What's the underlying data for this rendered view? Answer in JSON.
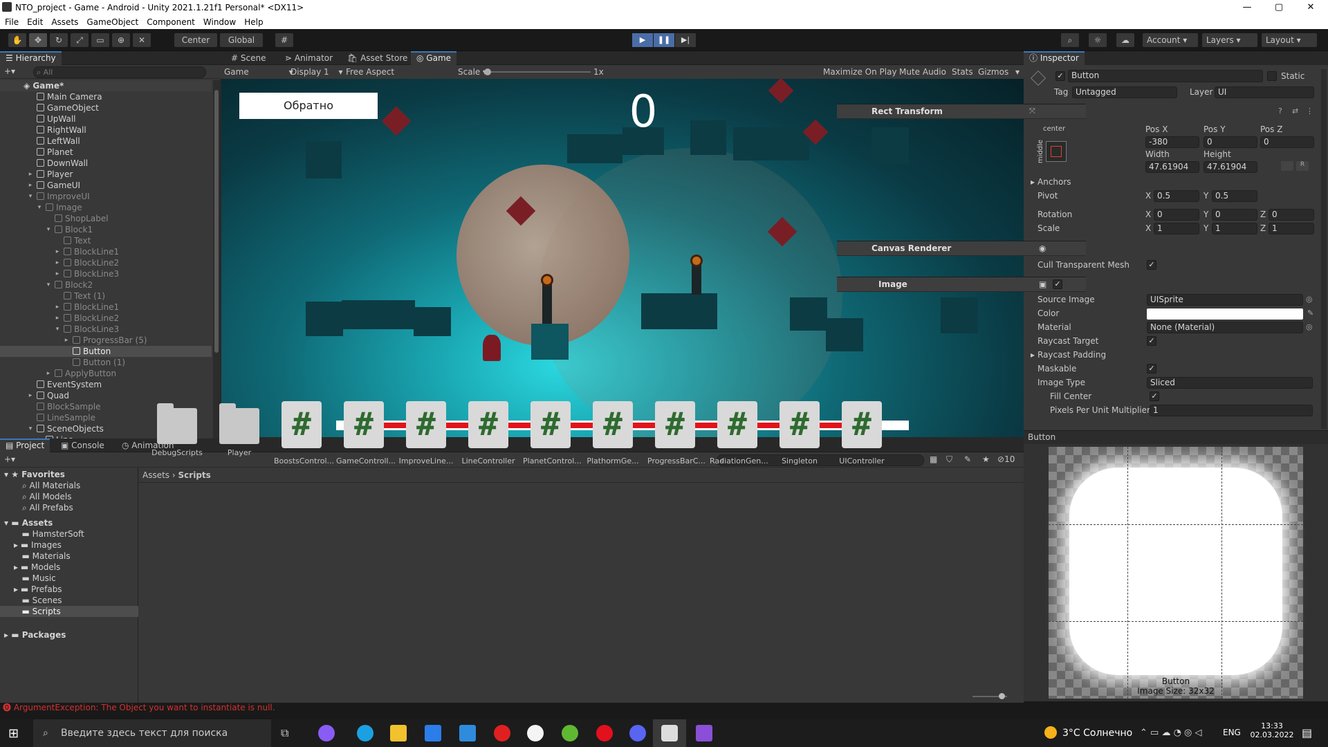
{
  "window": {
    "title": "NTO_project - Game - Android - Unity 2021.1.21f1 Personal* <DX11>",
    "min": "—",
    "max": "▢",
    "close": "✕"
  },
  "menu": [
    "File",
    "Edit",
    "Assets",
    "GameObject",
    "Component",
    "Window",
    "Help"
  ],
  "toolbar": {
    "center": "Center",
    "global": "Global",
    "account": "Account",
    "layers": "Layers",
    "layout": "Layout"
  },
  "hierarchy": {
    "tab": "Hierarchy",
    "search_placeholder": "All",
    "scene": "Game*",
    "items": [
      "Main Camera",
      "GameObject",
      "UpWall",
      "RightWall",
      "LeftWall",
      "Planet",
      "DownWall",
      "Player",
      "GameUI",
      "ImproveUI",
      "Image",
      "ShopLabel",
      "Block1",
      "Text",
      "BlockLine1",
      "BlockLine2",
      "BlockLine3",
      "Block2",
      "Text (1)",
      "BlockLine1",
      "BlockLine2",
      "BlockLine3",
      "ProgressBar (5)",
      "Button",
      "Button (1)",
      "ApplyButton",
      "EventSystem",
      "Quad",
      "BlockSample",
      "LineSample",
      "SceneObjects",
      "Line"
    ]
  },
  "center_tabs": [
    "Scene",
    "Animator",
    "Asset Store",
    "Game"
  ],
  "game_bar": {
    "mode": "Game",
    "display": "Display 1",
    "aspect": "Free Aspect",
    "scale_label": "Scale",
    "scale_value": "1x",
    "maximize": "Maximize On Play",
    "mute": "Mute Audio",
    "stats": "Stats",
    "gizmos": "Gizmos"
  },
  "game": {
    "back_button": "Обратно",
    "score": "0",
    "progress": 0.92
  },
  "inspector": {
    "tab": "Inspector",
    "object_name": "Button",
    "static": "Static",
    "tag_label": "Tag",
    "tag": "Untagged",
    "layer_label": "Layer",
    "layer": "UI",
    "rect": {
      "title": "Rect Transform",
      "anchor": "center",
      "side": "middle",
      "posx_l": "Pos X",
      "posy_l": "Pos Y",
      "posz_l": "Pos Z",
      "posx": "-380",
      "posy": "0",
      "posz": "0",
      "width_l": "Width",
      "height_l": "Height",
      "width": "47.61904",
      "height": "47.61904",
      "anchors": "Anchors",
      "pivot": "Pivot",
      "pivot_x": "0.5",
      "pivot_y": "0.5",
      "rotation": "Rotation",
      "rot_x": "0",
      "rot_y": "0",
      "rot_z": "0",
      "scale": "Scale",
      "sc_x": "1",
      "sc_y": "1",
      "sc_z": "1",
      "x": "X",
      "y": "Y",
      "z": "Z"
    },
    "canvas_renderer": {
      "title": "Canvas Renderer",
      "cull": "Cull Transparent Mesh"
    },
    "image": {
      "title": "Image",
      "source_l": "Source Image",
      "source": "UISprite",
      "color_l": "Color",
      "material_l": "Material",
      "material": "None (Material)",
      "raycast_target": "Raycast Target",
      "raycast_padding": "Raycast Padding",
      "maskable": "Maskable",
      "image_type_l": "Image Type",
      "image_type": "Sliced",
      "fill_center": "Fill Center",
      "ppu_l": "Pixels Per Unit Multiplier",
      "ppu": "1"
    },
    "preview": {
      "label": "Button",
      "caption": "Button",
      "size": "Image Size: 32x32"
    }
  },
  "bottom_tabs": [
    "Project",
    "Console",
    "Animation"
  ],
  "project": {
    "favorites": "Favorites",
    "fav_items": [
      "All Materials",
      "All Models",
      "All Prefabs"
    ],
    "assets": "Assets",
    "asset_folders": [
      "HamsterSoft",
      "Images",
      "Materials",
      "Models",
      "Music",
      "Prefabs",
      "Scenes",
      "Scripts"
    ],
    "packages": "Packages",
    "breadcrumb_root": "Assets",
    "breadcrumb_leaf": "Scripts",
    "hidden_count": "10",
    "files": [
      {
        "name": "DebugScripts",
        "type": "folder"
      },
      {
        "name": "Player",
        "type": "folder"
      },
      {
        "name": "BoostsControl...",
        "type": "script"
      },
      {
        "name": "GameControll...",
        "type": "script"
      },
      {
        "name": "ImproveLine...",
        "type": "script"
      },
      {
        "name": "LineController",
        "type": "script"
      },
      {
        "name": "PlanetControl...",
        "type": "script"
      },
      {
        "name": "PlathormGe...",
        "type": "script"
      },
      {
        "name": "ProgressBarC...",
        "type": "script"
      },
      {
        "name": "RadiationGen...",
        "type": "script"
      },
      {
        "name": "Singleton",
        "type": "script"
      },
      {
        "name": "UIController",
        "type": "script"
      }
    ]
  },
  "status": {
    "error": "ArgumentException: The Object you want to instantiate is null."
  },
  "taskbar": {
    "search": "Введите здесь текст для поиска",
    "weather": "3°C Солнечно",
    "lang": "ENG",
    "time": "13:33",
    "date": "02.03.2022"
  }
}
